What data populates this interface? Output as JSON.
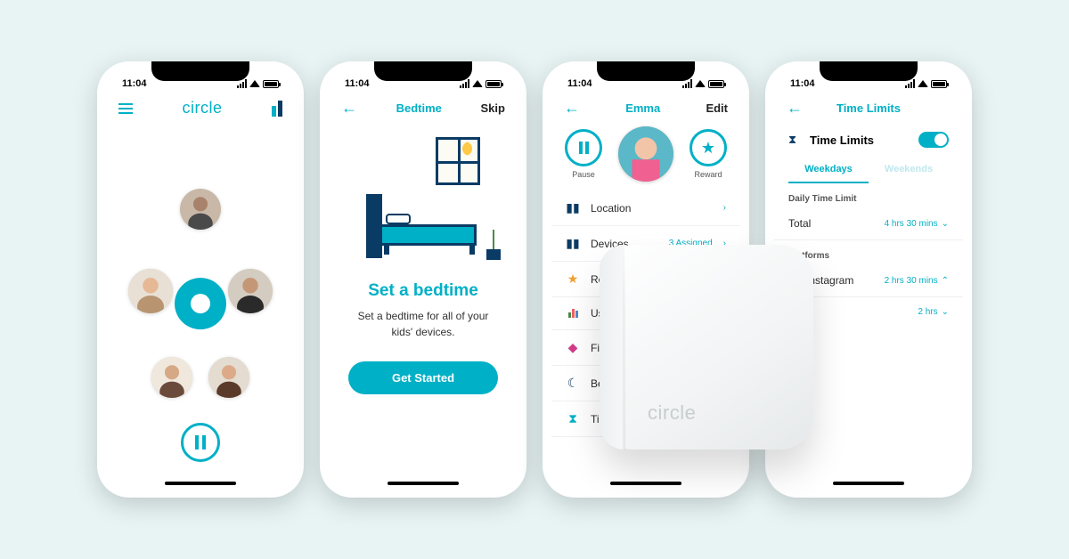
{
  "status_time": "11:04",
  "phone1": {
    "brand": "circle"
  },
  "phone2": {
    "nav_title": "Bedtime",
    "nav_right": "Skip",
    "title": "Set a bedtime",
    "subtitle": "Set a bedtime for all of your kids' devices.",
    "cta": "Get Started"
  },
  "phone3": {
    "name": "Emma",
    "edit": "Edit",
    "pause_label": "Pause",
    "reward_label": "Reward",
    "menu": [
      {
        "icon": "location-icon",
        "label": "Location",
        "value": ""
      },
      {
        "icon": "devices-icon",
        "label": "Devices",
        "value": "3 Assigned"
      },
      {
        "icon": "reward-icon",
        "label": "Rewards",
        "value": ""
      },
      {
        "icon": "usage-icon",
        "label": "Usage",
        "value": ""
      },
      {
        "icon": "filter-icon",
        "label": "Filter",
        "value": ""
      },
      {
        "icon": "bedtime-icon",
        "label": "Bedtime",
        "value": ""
      },
      {
        "icon": "time-icon",
        "label": "Time Limits",
        "value": ""
      }
    ]
  },
  "phone4": {
    "nav_title": "Time Limits",
    "heading": "Time Limits",
    "tab_active": "Weekdays",
    "tab_inactive": "Weekends",
    "section1": "Daily Time Limit",
    "total_label": "Total",
    "total_value": "4 hrs 30 mins",
    "section2": "Platforms",
    "platforms": [
      {
        "name": "Instagram",
        "value": "2 hrs 30 mins",
        "color": "#d13b8a"
      },
      {
        "name": "",
        "value": "2 hrs",
        "color": "#3b5998"
      }
    ]
  },
  "device_brand": "circle",
  "colors": {
    "accent": "#00b0c6",
    "navy": "#0a3b64"
  }
}
